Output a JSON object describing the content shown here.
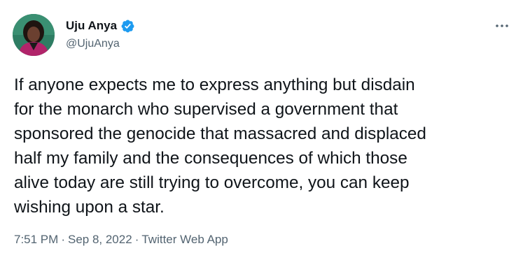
{
  "author": {
    "display_name": "Uju Anya",
    "handle": "@UjuAnya",
    "verified": true,
    "avatar_icon": "profile-photo"
  },
  "tweet": {
    "text": "If anyone expects me to express anything but disdain\nfor the monarch who supervised a government that\nsponsored the genocide that massacred and displaced\nhalf my family and the consequences of which those\nalive today are still trying to overcome, you can keep\nwishing upon a star."
  },
  "meta": {
    "time": "7:51 PM",
    "separator": "·",
    "date": "Sep 8, 2022",
    "source": "Twitter Web App"
  },
  "colors": {
    "verified_blue": "#1d9bf0",
    "secondary_text": "#536471",
    "primary_text": "#0f1419"
  },
  "icons": {
    "more": "more-options-icon",
    "verified": "verified-badge-icon"
  }
}
